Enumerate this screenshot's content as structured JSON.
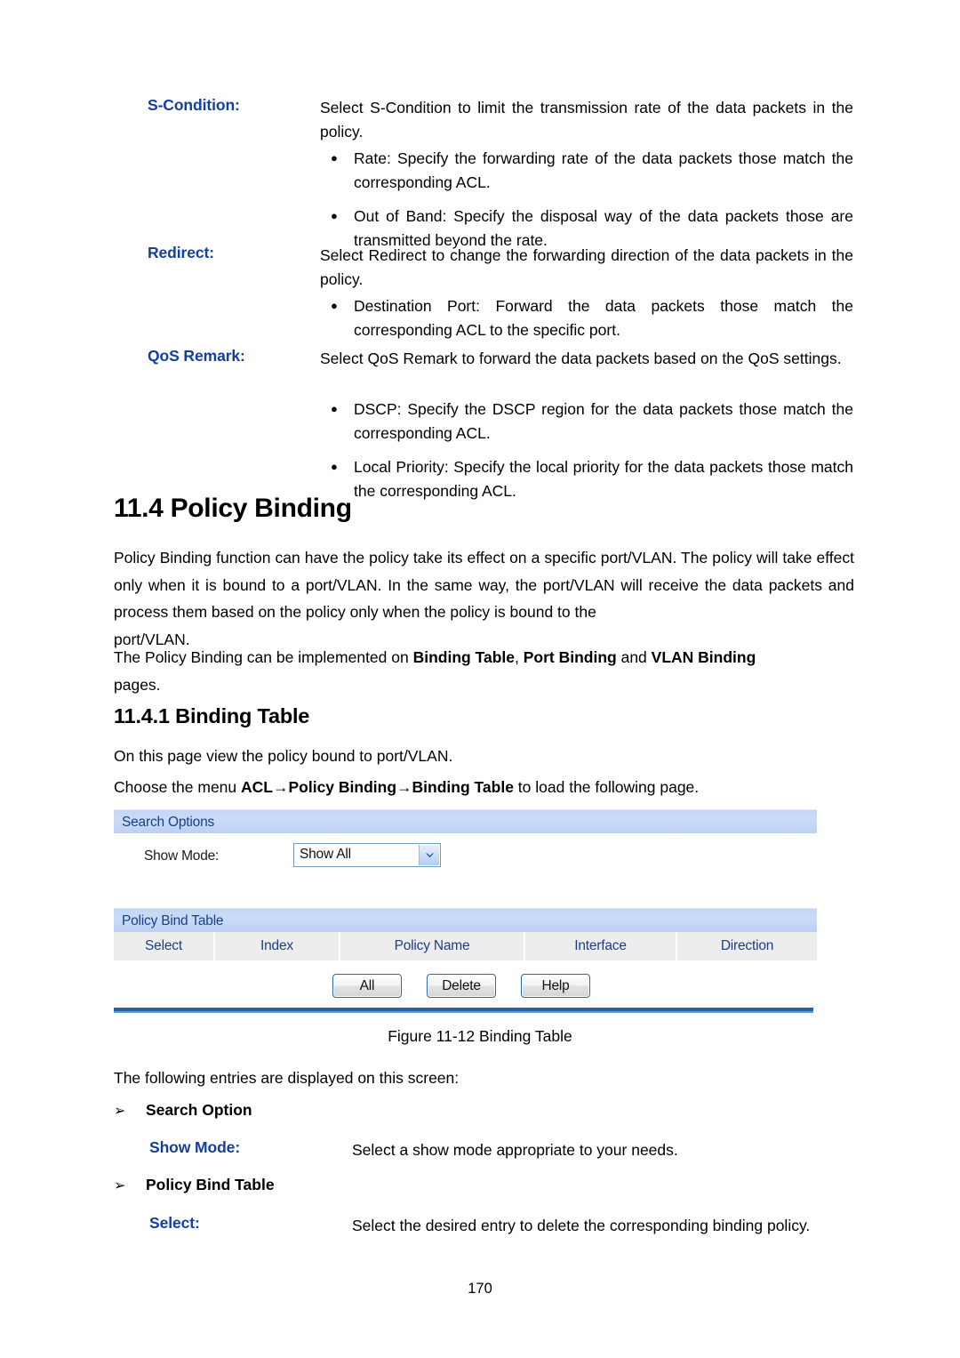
{
  "colors": {
    "term_blue": "#1340a0",
    "panel_header_blue": "#c6d9f6",
    "panel_header_text": "#1b3e86",
    "table_header_bg": "#ededed",
    "rule_blue": "#2b5fa8",
    "rule_blue_light": "#5b9bc4"
  },
  "definitions": [
    {
      "term": "S-Condition:",
      "body": "Select S-Condition to limit the transmission rate of the data packets in the policy.",
      "bullets": [
        "Rate: Specify the forwarding rate of the data packets those match the corresponding ACL.",
        "Out of Band: Specify the disposal way of the data packets those are transmitted beyond the rate."
      ]
    },
    {
      "term": "Redirect:",
      "body": "Select Redirect to change the forwarding direction of the data packets in the policy.",
      "bullets": [
        "Destination Port: Forward the data packets those match the corresponding ACL to the specific port."
      ]
    },
    {
      "term": "QoS Remark:",
      "body": "Select QoS Remark to forward the data packets based on the QoS settings.",
      "bullets": [
        "DSCP: Specify the DSCP region for the data packets those match the corresponding ACL.",
        "Local Priority: Specify the local priority for the data packets those match the corresponding ACL."
      ]
    }
  ],
  "section": {
    "heading": "11.4 Policy Binding",
    "intro_line1": "Policy Binding function can have the policy take its effect on a specific port/VLAN. The policy will take effect only when it is bound to a port/VLAN. In the same way, the port/VLAN will receive the data packets and process them based on the policy only when the policy is bound to the",
    "intro_last": "port/VLAN.",
    "implemented_prefix": "The Policy Binding can be implemented on ",
    "implemented_b1": "Binding Table",
    "implemented_mid1": ", ",
    "implemented_b2": "Port Binding",
    "implemented_mid2": " and ",
    "implemented_b3": "VLAN Binding",
    "implemented_last": "pages."
  },
  "subsection": {
    "heading": "11.4.1  Binding Table",
    "line1": "On this page view the policy bound to port/VLAN.",
    "choose_prefix": "Choose the menu ",
    "choose_b1": "ACL",
    "choose_arrow1": "→",
    "choose_b2": "Policy Binding",
    "choose_arrow2": "→",
    "choose_b3": "Binding Table",
    "choose_suffix": " to load the following page."
  },
  "ui": {
    "search_panel_title": "Search Options",
    "show_mode_label": "Show Mode:",
    "show_mode_value": "Show All",
    "show_mode_icon": "chevron-down-icon",
    "table_panel_title": "Policy Bind Table",
    "table_headers": [
      "Select",
      "Index",
      "Policy Name",
      "Interface",
      "Direction"
    ],
    "table_rows": [],
    "buttons": [
      "All",
      "Delete",
      "Help"
    ]
  },
  "figure": {
    "caption": "Figure 11-12 Binding Table"
  },
  "entries": {
    "lead_in": "The following entries are displayed on this screen:",
    "group1_title": "Search Option",
    "group1_arrow": "➢",
    "item1_term": "Show Mode:",
    "item1_desc": "Select a show mode appropriate to your needs.",
    "group2_title": "Policy Bind Table",
    "group2_arrow": "➢",
    "item2_term": "Select:",
    "item2_desc": "Select the desired entry to delete the corresponding binding policy."
  },
  "footer": {
    "page_number": "170"
  }
}
